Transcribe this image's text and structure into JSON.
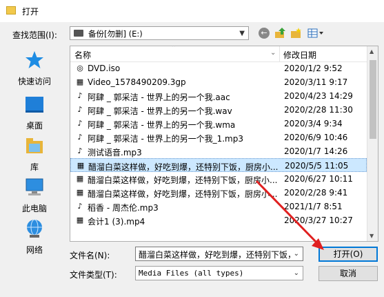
{
  "window": {
    "title": "打开"
  },
  "lookin": {
    "label": "查找范围(I):",
    "value": "备份[勿删] (E:)"
  },
  "sidebar": {
    "items": [
      {
        "label": "快速访问",
        "icon": "star-icon"
      },
      {
        "label": "桌面",
        "icon": "desktop-icon"
      },
      {
        "label": "库",
        "icon": "library-icon"
      },
      {
        "label": "此电脑",
        "icon": "computer-icon"
      },
      {
        "label": "网络",
        "icon": "network-icon"
      }
    ]
  },
  "filelist": {
    "col_name": "名称",
    "col_date": "修改日期",
    "rows": [
      {
        "name": "DVD.iso",
        "date": "2020/1/2 9:52",
        "icon": "disc-file-icon",
        "selected": false
      },
      {
        "name": "Video_1578490209.3gp",
        "date": "2020/3/11 9:17",
        "icon": "video-file-icon",
        "selected": false
      },
      {
        "name": "阿肆 _ 郭采洁 - 世界上的另一个我.aac",
        "date": "2020/4/23 14:29",
        "icon": "audio-file-icon",
        "selected": false
      },
      {
        "name": "阿肆 _ 郭采洁 - 世界上的另一个我.wav",
        "date": "2020/2/28 11:30",
        "icon": "audio-file-icon",
        "selected": false
      },
      {
        "name": "阿肆 _ 郭采洁 - 世界上的另一个我.wma",
        "date": "2020/3/4 9:34",
        "icon": "audio-file-icon",
        "selected": false
      },
      {
        "name": "阿肆 _ 郭采洁 - 世界上的另一个我_1.mp3",
        "date": "2020/6/9 10:46",
        "icon": "audio-file-icon",
        "selected": false
      },
      {
        "name": "测试语音.mp3",
        "date": "2020/1/7 14:26",
        "icon": "audio-file-icon",
        "selected": false
      },
      {
        "name": "醋溜白菜这样做，好吃到爆，还特别下饭，厨房小...",
        "date": "2020/5/5 11:05",
        "icon": "video-file-icon",
        "selected": true
      },
      {
        "name": "醋溜白菜这样做，好吃到爆，还特别下饭，厨房小...",
        "date": "2020/6/27 10:11",
        "icon": "video-file-icon",
        "selected": false
      },
      {
        "name": "醋溜白菜这样做，好吃到爆，还特别下饭，厨房小...",
        "date": "2020/2/28 9:41",
        "icon": "video-file-icon",
        "selected": false
      },
      {
        "name": "稻香 - 周杰伦.mp3",
        "date": "2021/1/7 8:51",
        "icon": "audio-file-icon",
        "selected": false
      },
      {
        "name": "会计1 (3).mp4",
        "date": "2020/3/27 10:27",
        "icon": "video-file-icon",
        "selected": false
      }
    ]
  },
  "form": {
    "filename_label": "文件名(N):",
    "filename_value": "醋溜白菜这样做，好吃到爆，还特别下饭，",
    "filetype_label": "文件类型(T):",
    "filetype_value": "Media Files (all types)"
  },
  "buttons": {
    "open": "打开(O)",
    "cancel": "取消"
  }
}
